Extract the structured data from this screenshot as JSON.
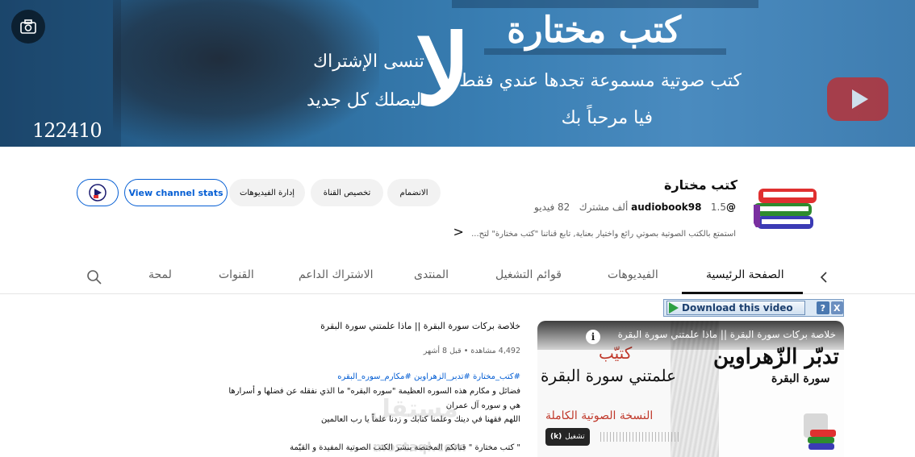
{
  "banner": {
    "title": "كتب مختارة",
    "subtitle_1": "كتب صوتية مسموعة تجدها عندي فقط",
    "subtitle_2": "فيا مرحباً بك",
    "big_letter": "لا",
    "subtitle_3": "تنسى الإشتراك",
    "subtitle_4": "ليصلك كل جديد",
    "number": "122410"
  },
  "channel": {
    "name": "كتب مختارة",
    "handle": "@audiobook98",
    "subscribers": "1.5 ألف مشترك",
    "videos": "82 فيديو",
    "description": "استمتع بالكتب الصوتية بصوتي رائع واختيار بعناية, تابع قناتنا \"كتب مختارة\" لتح...",
    "more": "<"
  },
  "buttons": {
    "join": "الانضمام",
    "customize": "تخصيص القناة",
    "manage_videos": "إدارة الفيديوهات",
    "stats": "View channel stats"
  },
  "tabs": [
    "الصفحة الرئيسية",
    "الفيديوهات",
    "قوائم التشغيل",
    "المنتدى",
    "الاشتراك الداعم",
    "القنوات",
    "لمحة"
  ],
  "download_bar": {
    "label": "Download this video",
    "help": "?",
    "close": "X"
  },
  "player": {
    "title": "خلاصة بركات سورة البقرة || ماذا علمتني سورة البقرة",
    "art_1": "كتيّب",
    "art_2": "علمتني سورة البقرة",
    "art_3": "النسخة الصوتية الكاملة",
    "art_4": "تدبّر الزّهراوين",
    "art_5": "سورة البقرة",
    "play_label": "تشغيل",
    "play_key": "(k)"
  },
  "video": {
    "title": "خلاصة بركات سورة البقرة || ماذا علمتني سورة البقرة",
    "meta": "4,492 مشاهدة • قبل 8 أشهر",
    "tags": "#كتب_مختارة #تدبر_الزهراوين #مكارم_سوره_البقره",
    "line_1": "فضائل و مكارم هذه السوره العظيمة \"سوره البقره\" ما الذي نفقله عن فضلها  و أسرارها",
    "line_2": "هي و سوره آل عمران",
    "line_3": "اللهم فقهنا في دينك وعلمنا كتابك و زدنا علماً يا رب العالمين",
    "line_4": "\" كتب مختارة \" قناتكم المختصة بنشر الكتب الصوتية المفيدة و القيّمة"
  },
  "watermark": {
    "text": "مستقل",
    "url": "mostaql.com"
  }
}
